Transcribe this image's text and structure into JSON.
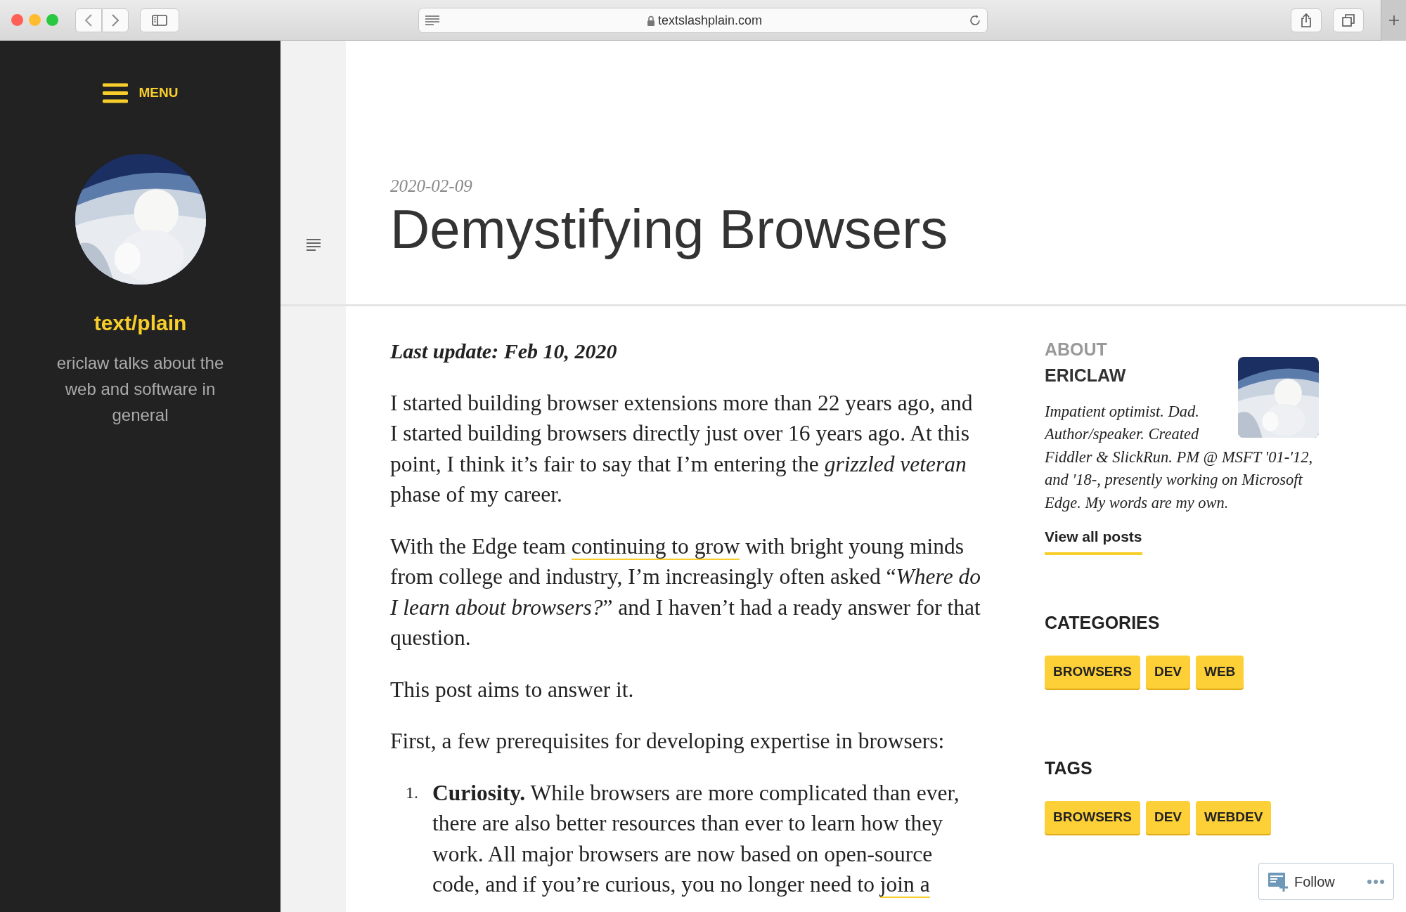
{
  "browser": {
    "url": "textslashplain.com"
  },
  "sidebar": {
    "menu_label": "MENU",
    "site_title": "text/plain",
    "tagline": "ericlaw talks about the web and software in general"
  },
  "post": {
    "date": "2020-02-09",
    "title": "Demystifying Browsers",
    "last_update": "Last update: Feb 10, 2020",
    "paragraphs": [
      [
        {
          "kind": "text",
          "text": "I started building browser extensions more than 22 years ago, and I started building browsers directly just over 16 years ago. At this point, I think it’s fair to say that I’m entering the *grizzled veteran* phase of my career."
        }
      ],
      [
        {
          "kind": "text",
          "text": "With the Edge team "
        },
        {
          "kind": "link",
          "text": "continuing to grow"
        },
        {
          "kind": "text",
          "text": " with bright young minds from college and industry, I’m increasingly often asked “*Where do I learn about browsers?*” and I haven’t had a ready answer for that question."
        }
      ],
      [
        {
          "kind": "text",
          "text": "This post aims to answer it."
        }
      ],
      [
        {
          "kind": "text",
          "text": "First, a few prerequisites for developing expertise in browsers:"
        }
      ]
    ],
    "list": [
      {
        "number": "1.",
        "parts": [
          {
            "kind": "text",
            "text": "**Curiosity.** While browsers are more complicated than ever, there are also better resources than ever to learn how they work. All major browsers are now based on open-source code, and if you’re curious, you no longer need to "
          },
          {
            "kind": "link",
            "text": "join a"
          }
        ]
      }
    ]
  },
  "about": {
    "heading": "ABOUT",
    "name": "ERICLAW",
    "bio": "Impatient optimist. Dad. Author/speaker. Created Fiddler & SlickRun. PM @ MSFT '01-'12, and '18-, presently working on Microsoft Edge. My words are my own.",
    "link": "View all posts"
  },
  "categories": {
    "heading": "CATEGORIES",
    "items": [
      "BROWSERS",
      "DEV",
      "WEB"
    ]
  },
  "tags": {
    "heading": "TAGS",
    "items": [
      "BROWSERS",
      "DEV",
      "WEBDEV"
    ]
  },
  "follow": {
    "label": "Follow"
  }
}
